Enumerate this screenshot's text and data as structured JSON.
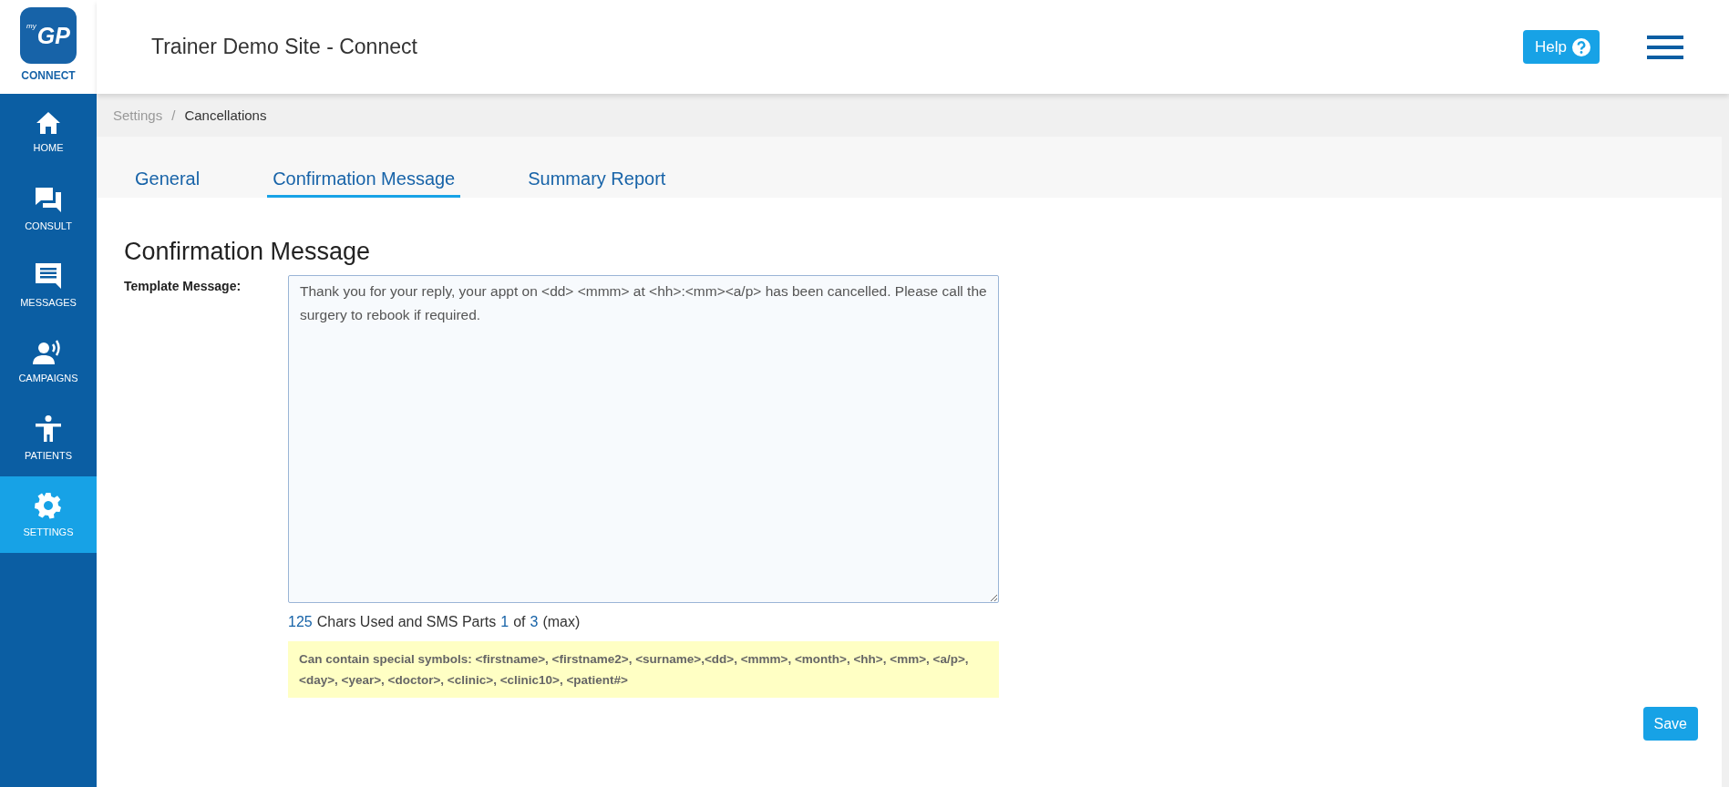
{
  "logo": {
    "mark": "GP",
    "prefix": "my",
    "caption": "CONNECT"
  },
  "header": {
    "title": "Trainer Demo Site - Connect",
    "help_button": "Help"
  },
  "sidebar": {
    "items": [
      {
        "label": "HOME",
        "kind": "home",
        "selected": false
      },
      {
        "label": "CONSULT",
        "kind": "consult",
        "selected": false
      },
      {
        "label": "MESSAGES",
        "kind": "messages",
        "selected": false
      },
      {
        "label": "CAMPAIGNS",
        "kind": "campaigns",
        "selected": false
      },
      {
        "label": "PATIENTS",
        "kind": "patients",
        "selected": false
      },
      {
        "label": "SETTINGS",
        "kind": "settings",
        "selected": true
      }
    ]
  },
  "breadcrumb": [
    {
      "label": "Settings",
      "current": false
    },
    {
      "label": "Cancellations",
      "current": true
    }
  ],
  "breadcrumb_separator": "/",
  "tabs": [
    {
      "label": "General",
      "selected": false
    },
    {
      "label": "Confirmation Message",
      "selected": true
    },
    {
      "label": "Summary Report",
      "selected": false
    }
  ],
  "form": {
    "heading": "Confirmation Message",
    "label": "Template Message:",
    "value": "Thank you for your reply, your appt on <dd> <mmm> at <hh>:<mm><a/p> has been cancelled. Please call the surgery to rebook if required.",
    "counter": {
      "chars": "125",
      "chars_label": "Chars Used and SMS Parts",
      "part": "1",
      "of": "of",
      "total": "3",
      "suffix": "(max)"
    },
    "hint": "Can contain special symbols: <firstname>, <firstname2>, <surname>,<dd>, <mmm>, <month>, <hh>, <mm>, <a/p>, <day>, <year>, <doctor>, <clinic>, <clinic10>, <patient#>",
    "save_button": "Save"
  }
}
